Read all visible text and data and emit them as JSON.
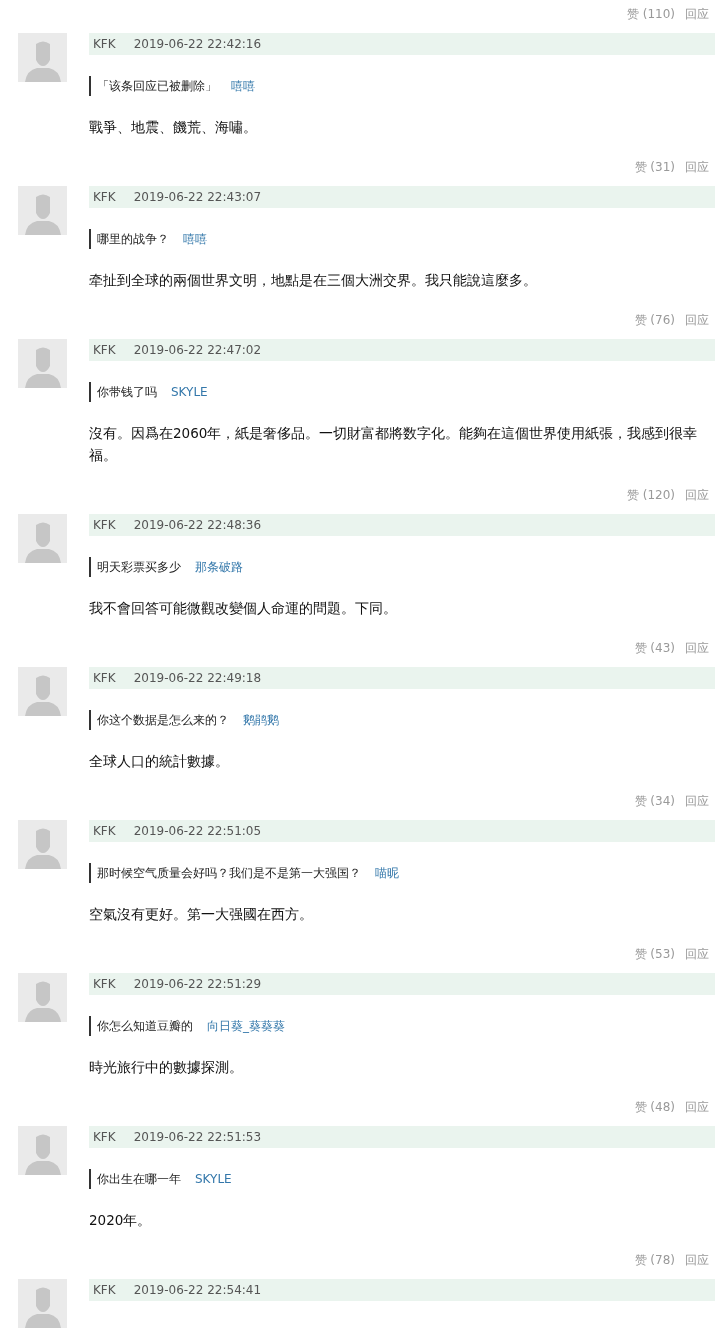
{
  "leading_actions": {
    "like": "赞 (110)",
    "reply": "回应"
  },
  "comments": [
    {
      "user": "KFK",
      "time": "2019-06-22 22:42:16",
      "quote": {
        "text": "「该条回应已被删除」",
        "author": "嘻嘻"
      },
      "body": "戰爭、地震、饑荒、海嘯。",
      "actions": {
        "like": "赞 (31)",
        "reply": "回应"
      }
    },
    {
      "user": "KFK",
      "time": "2019-06-22 22:43:07",
      "quote": {
        "text": "哪里的战争？",
        "author": "嘻嘻"
      },
      "body": "牵扯到全球的兩個世界文明，地點是在三個大洲交界。我只能說這麼多。",
      "actions": {
        "like": "赞 (76)",
        "reply": "回应"
      }
    },
    {
      "user": "KFK",
      "time": "2019-06-22 22:47:02",
      "quote": {
        "text": "你带钱了吗",
        "author": "SKYLE"
      },
      "body": "沒有。因爲在2060年，紙是奢侈品。一切財富都將数字化。能夠在這個世界使用紙張，我感到很幸福。",
      "actions": {
        "like": "赞 (120)",
        "reply": "回应"
      }
    },
    {
      "user": "KFK",
      "time": "2019-06-22 22:48:36",
      "quote": {
        "text": "明天彩票买多少",
        "author": "那条破路"
      },
      "body": "我不會回答可能微觀改變個人命運的問題。下同。",
      "actions": {
        "like": "赞 (43)",
        "reply": "回应"
      }
    },
    {
      "user": "KFK",
      "time": "2019-06-22 22:49:18",
      "quote": {
        "text": "你这个数据是怎么来的？",
        "author": "鹅鹃鹅"
      },
      "body": "全球人口的統計數據。",
      "actions": {
        "like": "赞 (34)",
        "reply": "回应"
      }
    },
    {
      "user": "KFK",
      "time": "2019-06-22 22:51:05",
      "quote": {
        "text": "那时候空气质量会好吗？我们是不是第一大强国？",
        "author": "喵昵"
      },
      "body": "空氣沒有更好。第一大强國在西方。",
      "actions": {
        "like": "赞 (53)",
        "reply": "回应"
      }
    },
    {
      "user": "KFK",
      "time": "2019-06-22 22:51:29",
      "quote": {
        "text": "你怎么知道豆瓣的",
        "author": "向日葵_葵葵葵"
      },
      "body": "時光旅行中的數據探測。",
      "actions": {
        "like": "赞 (48)",
        "reply": "回应"
      }
    },
    {
      "user": "KFK",
      "time": "2019-06-22 22:51:53",
      "quote": {
        "text": "你出生在哪一年",
        "author": "SKYLE"
      },
      "body": "2020年。",
      "actions": {
        "like": "赞 (78)",
        "reply": "回应"
      }
    },
    {
      "user": "KFK",
      "time": "2019-06-22 22:54:41"
    }
  ]
}
